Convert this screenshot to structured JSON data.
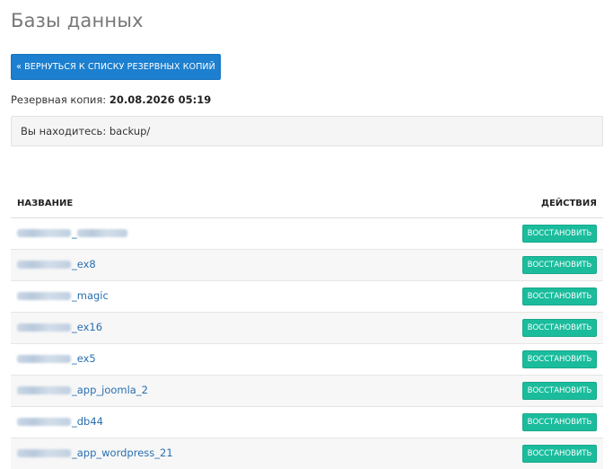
{
  "header": {
    "title": "Базы данных"
  },
  "toolbar": {
    "back_label": "« ВЕРНУТЬСЯ К СПИСКУ РЕЗЕРВНЫХ КОПИЙ"
  },
  "backup": {
    "label": "Резервная копия: ",
    "value": "20.08.2026 05:19"
  },
  "location": {
    "text": "Вы находитесь: backup/"
  },
  "table": {
    "columns": {
      "name": "НАЗВАНИЕ",
      "actions": "ДЕЙСТВИЯ"
    },
    "restore_label": "ВОССТАНОВИТЬ",
    "rows": [
      {
        "suffix": "_"
      },
      {
        "suffix": "_ex8"
      },
      {
        "suffix": "_magic"
      },
      {
        "suffix": "_ex16"
      },
      {
        "suffix": "_ex5"
      },
      {
        "suffix": "_app_joomla_2"
      },
      {
        "suffix": "_db44"
      },
      {
        "suffix": "_app_wordpress_21"
      }
    ]
  },
  "colors": {
    "primary_button": "#1c7fcf",
    "restore_button": "#1abc9c",
    "link": "#2a6fb0"
  }
}
